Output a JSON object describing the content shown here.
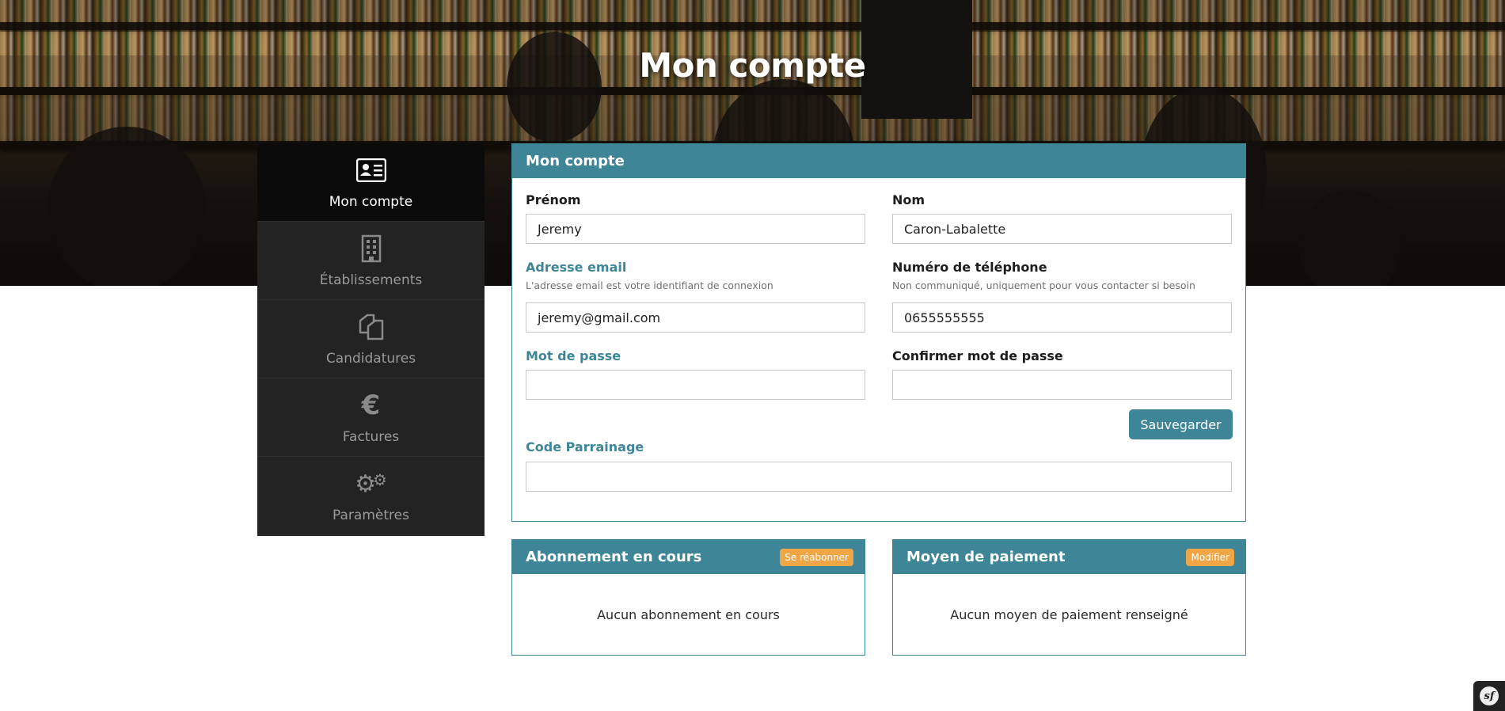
{
  "hero": {
    "title": "Mon compte"
  },
  "sidebar": {
    "items": [
      {
        "label": "Mon compte",
        "icon": "id-card-icon",
        "active": true
      },
      {
        "label": "Établissements",
        "icon": "building-icon",
        "active": false
      },
      {
        "label": "Candidatures",
        "icon": "documents-icon",
        "active": false
      },
      {
        "label": "Factures",
        "icon": "euro-icon",
        "active": false
      },
      {
        "label": "Paramètres",
        "icon": "gears-icon",
        "active": false
      }
    ]
  },
  "account": {
    "title": "Mon compte",
    "firstname": {
      "label": "Prénom",
      "value": "Jeremy"
    },
    "lastname": {
      "label": "Nom",
      "value": "Caron-Labalette"
    },
    "email": {
      "label": "Adresse email",
      "help": "L'adresse email est votre identifiant de connexion",
      "value": "jeremy@gmail.com"
    },
    "phone": {
      "label": "Numéro de téléphone",
      "help": "Non communiqué, uniquement pour vous contacter si besoin",
      "value": "0655555555"
    },
    "password": {
      "label": "Mot de passe",
      "value": ""
    },
    "password_confirm": {
      "label": "Confirmer mot de passe",
      "value": ""
    },
    "save_label": "Sauvegarder",
    "referral": {
      "label": "Code Parrainage",
      "value": ""
    }
  },
  "subscription": {
    "title": "Abonnement en cours",
    "action": "Se réabonner",
    "empty": "Aucun abonnement en cours"
  },
  "payment": {
    "title": "Moyen de paiement",
    "action": "Modifier",
    "empty": "Aucun moyen de paiement renseigné"
  },
  "toolbar": {
    "label": "sf"
  },
  "colors": {
    "accent": "#3e8598",
    "badge": "#f0a546",
    "sidebar": "#232323",
    "sidebar_active": "#0b0b0b"
  }
}
